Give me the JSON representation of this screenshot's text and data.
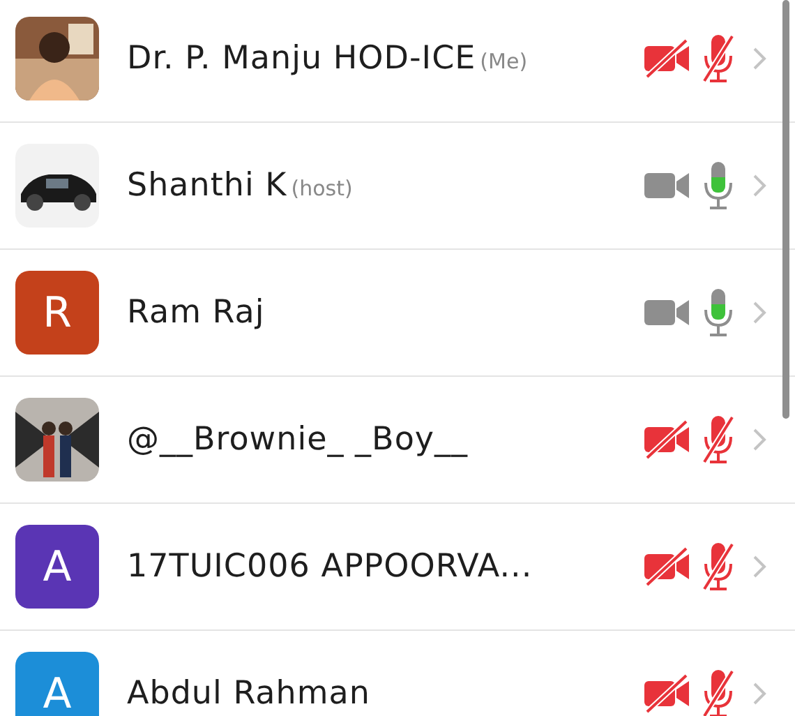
{
  "participants": [
    {
      "name": "Dr. P. Manju HOD-ICE",
      "tag": "(Me)",
      "video_off": true,
      "muted": true
    },
    {
      "name": "Shanthi K",
      "tag": "(host)",
      "video_off": false,
      "muted": false
    },
    {
      "name": "Ram Raj",
      "avatar": {
        "kind": "letter",
        "letter": "R",
        "color": "#c4411b"
      },
      "video_off": false,
      "muted": false
    },
    {
      "name": "@__Brownie_ _Boy__",
      "video_off": true,
      "muted": true
    },
    {
      "name": "17TUIC006 APPOORVA...",
      "avatar": {
        "kind": "letter",
        "letter": "A",
        "color": "#5a35b4"
      },
      "video_off": true,
      "muted": true
    },
    {
      "name": "Abdul Rahman",
      "avatar": {
        "kind": "letter",
        "letter": "A",
        "color": "#1c8ed8"
      },
      "video_off": true,
      "muted": true
    }
  ]
}
